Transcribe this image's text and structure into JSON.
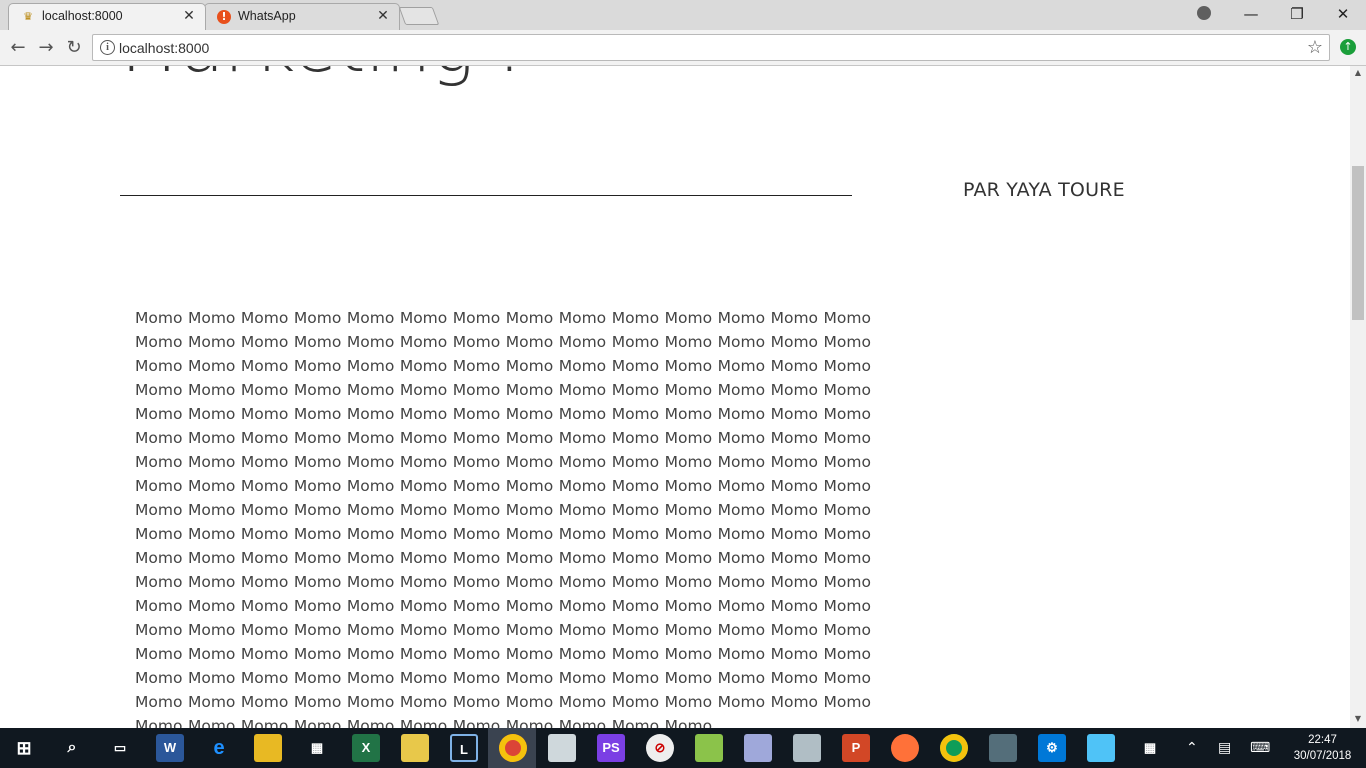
{
  "browser": {
    "tabs": [
      {
        "title": "localhost:8000",
        "favicon": "laravel-icon",
        "active": true
      },
      {
        "title": "WhatsApp",
        "favicon": "alert-icon",
        "active": false
      }
    ],
    "url": "localhost:8000"
  },
  "page": {
    "heading": "Marketing :",
    "author": "PAR YAYA TOURE",
    "body_text": "Momo Momo Momo Momo Momo Momo Momo Momo Momo Momo Momo Momo Momo Momo Momo Momo Momo Momo Momo Momo Momo Momo Momo Momo Momo Momo Momo Momo Momo Momo Momo Momo Momo Momo Momo Momo Momo Momo Momo Momo Momo Momo Momo Momo Momo Momo Momo Momo Momo Momo Momo Momo Momo Momo Momo Momo Momo Momo Momo Momo Momo Momo Momo Momo Momo Momo Momo Momo Momo Momo Momo Momo Momo Momo Momo Momo Momo Momo Momo Momo Momo Momo Momo Momo Momo Momo Momo Momo Momo Momo Momo Momo Momo Momo Momo Momo Momo Momo Momo Momo Momo Momo Momo Momo Momo Momo Momo Momo Momo Momo Momo Momo Momo Momo Momo Momo Momo Momo Momo Momo Momo Momo Momo Momo Momo Momo Momo Momo Momo Momo Momo Momo Momo Momo Momo Momo Momo Momo Momo Momo Momo Momo Momo Momo Momo Momo Momo Momo Momo Momo Momo Momo Momo Momo Momo Momo Momo Momo Momo Momo Momo Momo Momo Momo Momo Momo Momo Momo Momo Momo Momo Momo Momo Momo Momo Momo Momo Momo Momo Momo Momo Momo Momo Momo Momo Momo Momo Momo Momo Momo Momo Momo Momo Momo Momo Momo Momo Momo Momo Momo Momo Momo Momo Momo Momo Momo Momo Momo Momo Momo Momo Momo Momo Momo Momo Momo Momo Momo Momo Momo Momo Momo Momo Momo Momo Momo Momo Momo Momo Momo Momo Momo Momo Momo Momo Momo Momo Momo Momo Momo Momo Momo Momo Momo Momo Momo Momo Momo Momo"
  },
  "taskbar": {
    "time": "22:47",
    "date": "30/07/2018"
  },
  "colors": {
    "tabstrip": "#dadada",
    "toolbar": "#f2f2f2",
    "taskbar": "#101820",
    "text": "#444444"
  }
}
